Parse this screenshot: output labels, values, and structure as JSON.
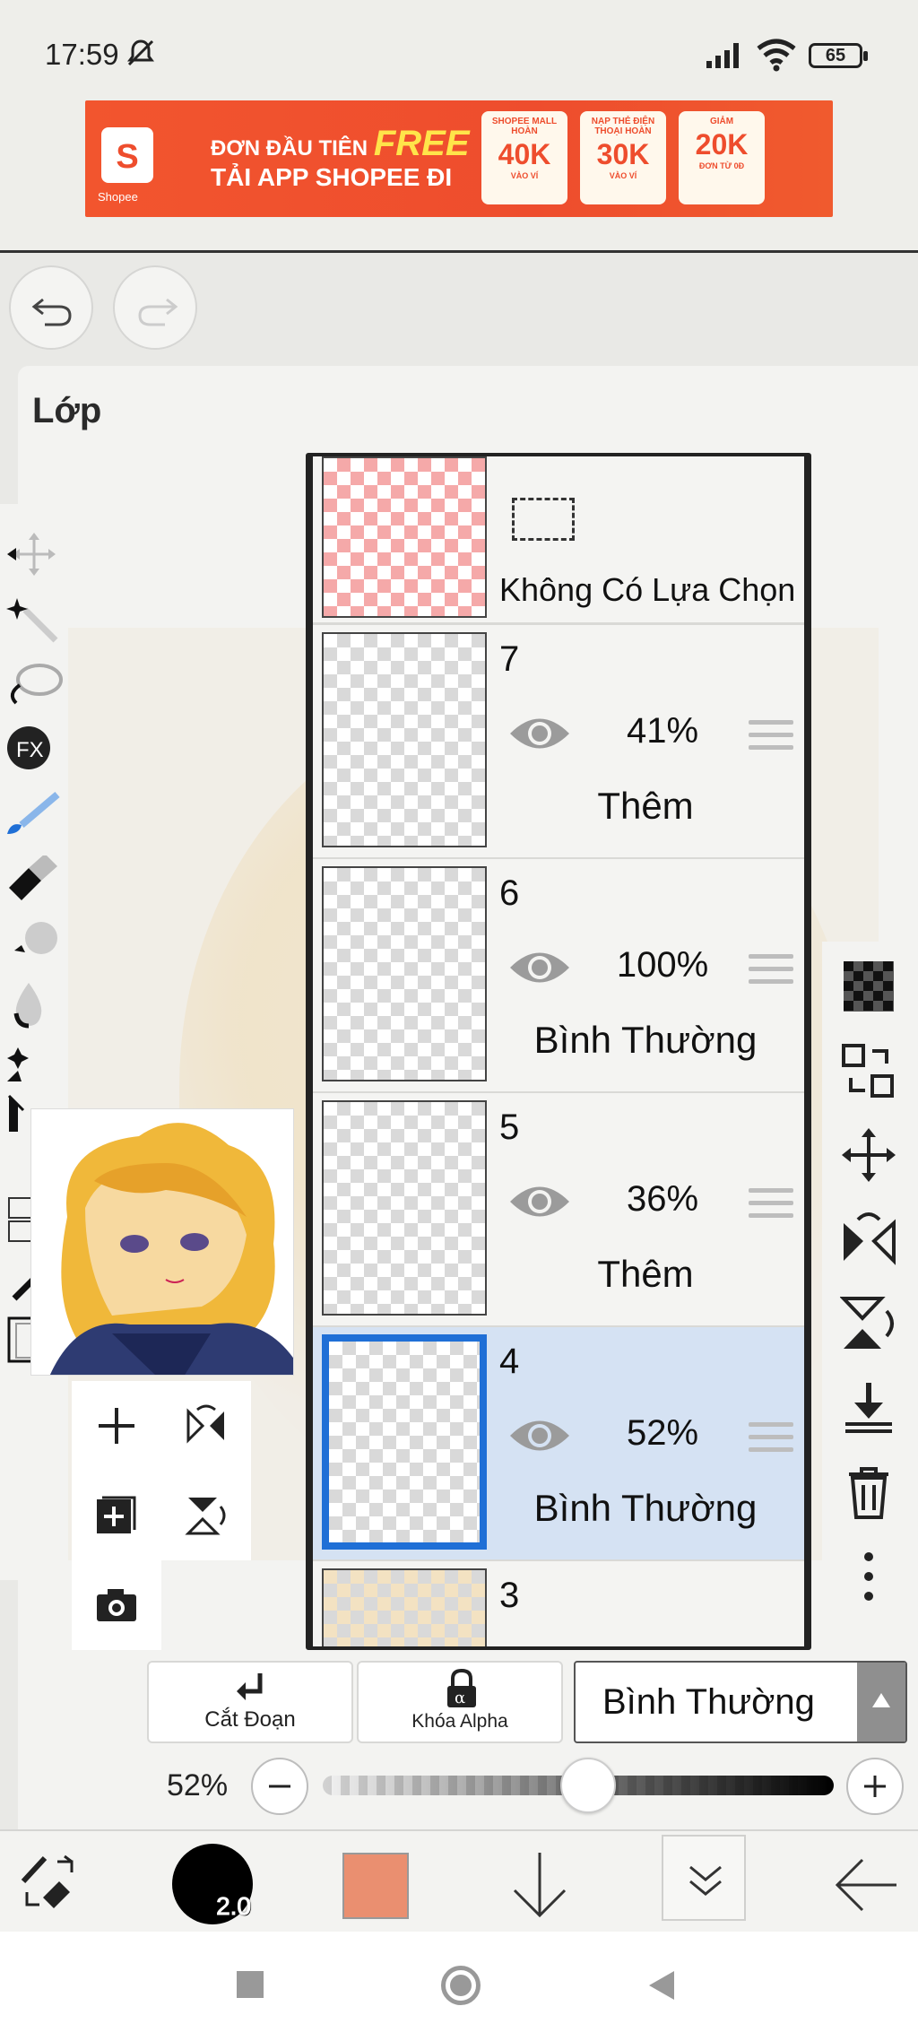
{
  "status_bar": {
    "time": "17:59",
    "battery": "65"
  },
  "ad": {
    "brand": "Shopee",
    "line1_prefix": "ĐƠN ĐẦU TIÊN",
    "line1_free": "FREE",
    "line2": "TẢI APP SHOPEE ĐI",
    "vouchers": [
      {
        "title": "SHOPEE MALL HOÀN",
        "value": "40K",
        "sub": "VÀO VÍ"
      },
      {
        "title": "NẠP THẺ ĐIỆN THOẠI HOÀN",
        "value": "30K",
        "sub": "VÀO VÍ"
      },
      {
        "title": "GIẢM",
        "value": "20K",
        "sub": "ĐƠN TỪ 0Đ"
      }
    ]
  },
  "panel": {
    "title": "Lớp"
  },
  "layers": [
    {
      "label": "Không Có Lựa Chọn"
    },
    {
      "number": "7",
      "opacity": "41%",
      "mode": "Thêm"
    },
    {
      "number": "6",
      "opacity": "100%",
      "mode": "Bình Thường"
    },
    {
      "number": "5",
      "opacity": "36%",
      "mode": "Thêm"
    },
    {
      "number": "4",
      "opacity": "52%",
      "mode": "Bình Thường",
      "selected": true
    },
    {
      "number": "3"
    }
  ],
  "controls": {
    "clip_label": "Cắt Đoạn",
    "alpha_lock_label": "Khóa Alpha",
    "blend_mode": "Bình Thường",
    "opacity_label": "52%",
    "opacity_value": 0.52
  },
  "toolbar": {
    "brush_size": "2.0",
    "color": "#ea8f70"
  },
  "colors": {
    "selected_layer_bg": "#d5e2f3",
    "selected_border": "#1f6fd6",
    "ad_orange": "#ee4d2d"
  }
}
